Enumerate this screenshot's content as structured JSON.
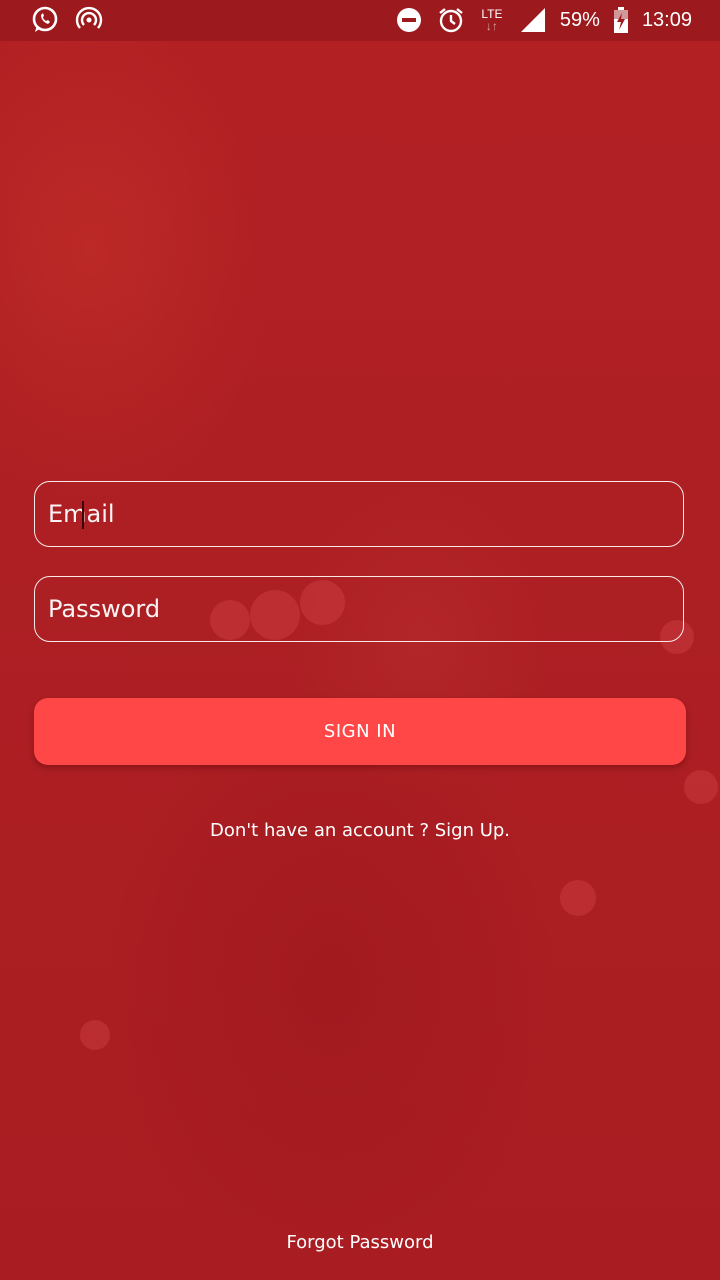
{
  "status_bar": {
    "left_icons": [
      "whatsapp-icon",
      "hotspot-icon"
    ],
    "right_icons": [
      "do-not-disturb-icon",
      "alarm-icon",
      "lte-icon",
      "signal-icon",
      "battery-charging-icon"
    ],
    "network_label": "LTE",
    "battery": "59%",
    "time": "13:09"
  },
  "form": {
    "email_placeholder": "Email",
    "password_placeholder": "Password",
    "signin_label": "SIGN IN",
    "signup_text": "Don't have an account ? Sign Up.",
    "forgot_text": "Forgot Password"
  },
  "colors": {
    "background": "#ad1f23",
    "status_bar": "#9c1a1d",
    "button": "#ff4747",
    "text": "#ffffff"
  }
}
